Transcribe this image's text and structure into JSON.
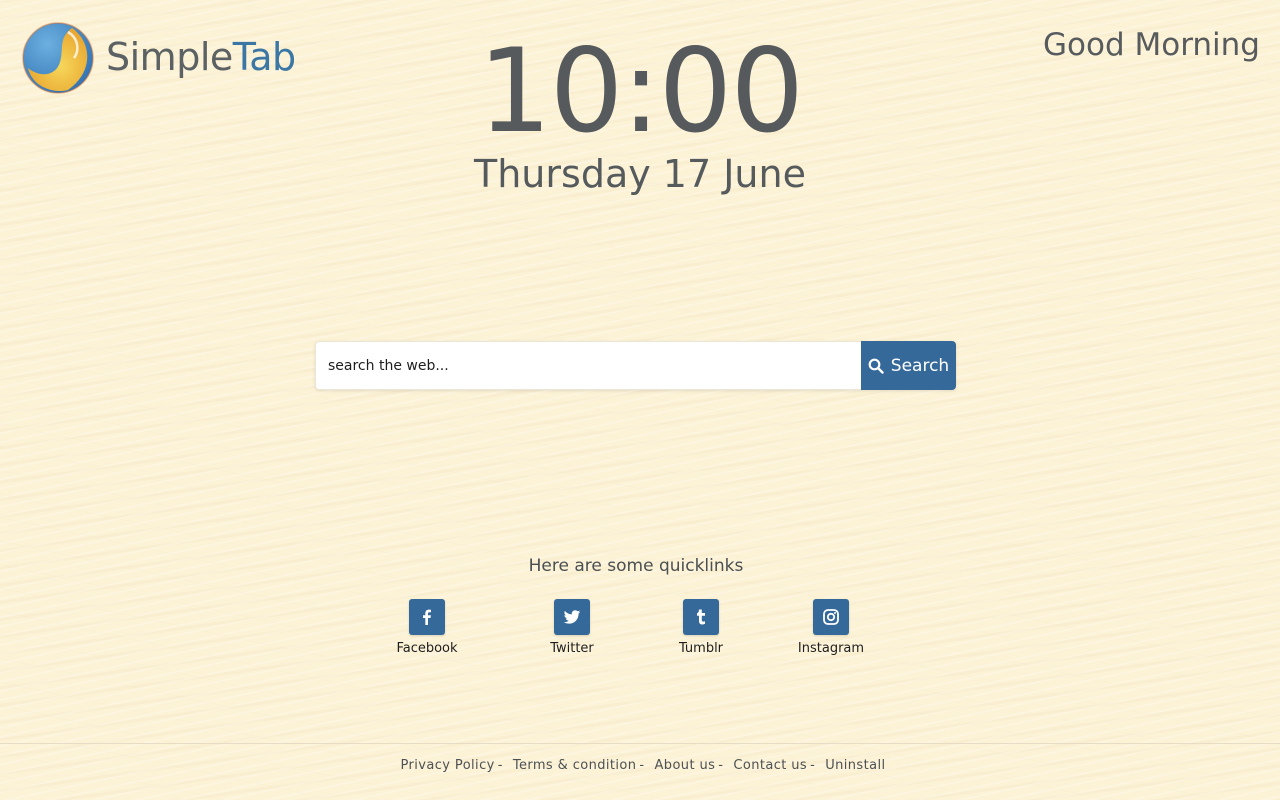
{
  "brand": {
    "name_part1": "Simple",
    "name_part2": "Tab",
    "colors": {
      "simple": "#5c6164",
      "tab": "#3b77a5",
      "accent": "#35699a"
    }
  },
  "greeting": "Good Morning",
  "clock": {
    "time": "10:00",
    "date": "Thursday 17 June"
  },
  "search": {
    "placeholder": "search the web...",
    "value": "",
    "button_label": "Search",
    "button_icon": "search-icon"
  },
  "quicklinks": {
    "heading": "Here are some quicklinks",
    "items": [
      {
        "label": "Facebook",
        "icon": "facebook-icon"
      },
      {
        "label": "Twitter",
        "icon": "twitter-icon"
      },
      {
        "label": "Tumblr",
        "icon": "tumblr-icon"
      },
      {
        "label": "Instagram",
        "icon": "instagram-icon"
      }
    ]
  },
  "footer": {
    "separator": "-",
    "links": [
      {
        "label": "Privacy Policy"
      },
      {
        "label": "Terms & condition"
      },
      {
        "label": "About us"
      },
      {
        "label": "Contact us"
      },
      {
        "label": "Uninstall"
      }
    ]
  }
}
